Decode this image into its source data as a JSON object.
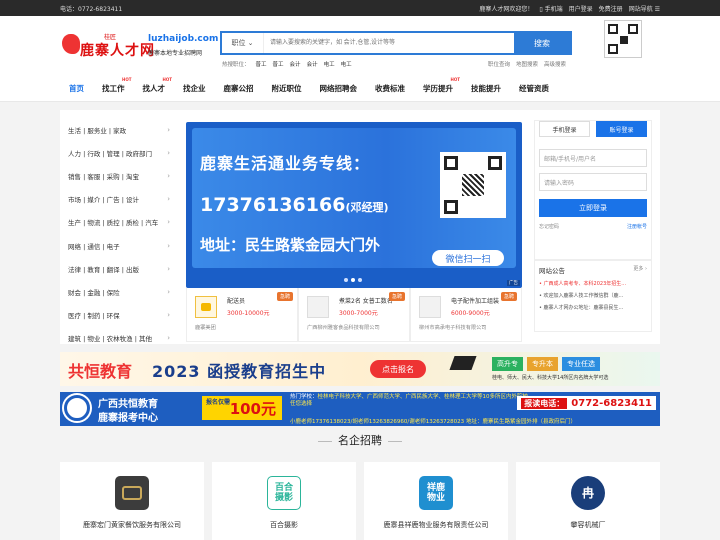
{
  "topbar": {
    "phone": "电话：0772-6823411",
    "welcome": "鹿寨人才网欢迎您！",
    "mobile": "手机端",
    "user_login": "用户登录",
    "register": "免费注册",
    "site_nav": "网站导航"
  },
  "brand": {
    "name": "鹿寨人才网",
    "small": "桂匠",
    "domain": "luzhaijob.com",
    "slogan": "鹿寨本地专业招聘网"
  },
  "search": {
    "category": "职位",
    "placeholder": "请输入要搜索的关键字，如 会计,仓管,设计等等",
    "button": "搜索",
    "hot_label": "热搜职位：",
    "hot": [
      "普工",
      "普工",
      "会计",
      "会计",
      "电工",
      "电工"
    ],
    "links": [
      "职位查询",
      "地图搜索",
      "高级搜索"
    ]
  },
  "nav": [
    {
      "label": "首页",
      "hot": ""
    },
    {
      "label": "找工作",
      "hot": "HOT"
    },
    {
      "label": "找人才",
      "hot": "HOT"
    },
    {
      "label": "找企业",
      "hot": ""
    },
    {
      "label": "鹿寨公招",
      "hot": ""
    },
    {
      "label": "附近职位",
      "hot": ""
    },
    {
      "label": "网络招聘会",
      "hot": ""
    },
    {
      "label": "收费标准",
      "hot": ""
    },
    {
      "label": "学历提升",
      "hot": "HOT"
    },
    {
      "label": "技能提升",
      "hot": ""
    },
    {
      "label": "经管资质",
      "hot": ""
    }
  ],
  "categories": [
    "生活 | 服务业 | 家政",
    "人力 | 行政 | 管理 | 政府部门",
    "销售 | 客服 | 采购 | 淘宝",
    "市场 | 媒介 | 广告 | 设计",
    "生产 | 物流 | 质控 | 质检 | 汽车",
    "网络 | 通信 | 电子",
    "法律 | 教育 | 翻译 | 出版",
    "财会 | 金融 | 保险",
    "医疗 | 制药 | 环保",
    "建筑 | 物业 | 农林牧渔 | 其他"
  ],
  "banner": {
    "title": "鹿寨生活通业务专线：",
    "phone": "17376136166",
    "contact": "(邓经理)",
    "address": "地址：民生路紫金园大门外",
    "scan": "微信扫一扫",
    "ad": "广告"
  },
  "jobs": [
    {
      "title": "配送员",
      "salary": "3000-10000元",
      "company": "鹿寨美团",
      "tag": "急聘"
    },
    {
      "title": "煮菜2名 女普工数名",
      "salary": "3000-7000元",
      "company": "广西柳州雅客食品科技有限公司",
      "tag": "急聘"
    },
    {
      "title": "电子配件加工组装",
      "salary": "6000-9000元",
      "company": "柳州市高承电子科技有限公司",
      "tag": "急聘"
    }
  ],
  "login": {
    "tab_mobile": "手机登录",
    "tab_account": "账号登录",
    "username_placeholder": "邮箱/手机号/用户名",
    "password_placeholder": "请输入密码",
    "submit": "立即登录",
    "forgot": "忘记密码",
    "register": "注册帐号"
  },
  "notice": {
    "title": "网站公告",
    "more": "更多",
    "items": [
      "广西成人高考专、本科2023年招生...",
      "欢迎加入鹿寨人技工作微信群（鹿...",
      "鹿寨人才网办公地址：鹿寨县民生..."
    ]
  },
  "ad1": {
    "brand": "共恒教育",
    "headline": "2023 函授教育招生中",
    "cta": "点击报名",
    "tags": [
      "高升专",
      "专升本",
      "专业任选"
    ],
    "schools": "桂电、师大、民大、科技大学14所区内名牌大学可选",
    "ad": "广告"
  },
  "ad2": {
    "line1": "广西共恒教育",
    "line2": "鹿寨报考中心",
    "price_label": "报名仅需",
    "price": "100元",
    "hot": "热门学校：",
    "schools": "桂林电子科技大学、广西师范大学、广西民族大学、桂林理工大学等10多所区内外院校任您选择",
    "contacts": "小鹿老师17376138023/胡老师13263826960/谢老师13263728023",
    "phone_label": "报读电话：",
    "phone": "0772-6823411",
    "address": "地址：鹿寨民生路紫金园外排（县政府后门）"
  },
  "section_title": "名企招聘",
  "companies": [
    {
      "name": "鹿寨宏门黄家餐饮服务有限公司",
      "logo_text": "",
      "color": "#3c3c3c"
    },
    {
      "name": "百合摄影",
      "logo_text": "百合\n摄影",
      "color": "#2bb59a"
    },
    {
      "name": "鹿寨县祥鹿物业服务有限责任公司",
      "logo_text": "祥鹿\n物业",
      "color": "#1f8fd0"
    },
    {
      "name": "攀容机械厂",
      "logo_text": "冉",
      "color": "#1a3e7a"
    }
  ]
}
